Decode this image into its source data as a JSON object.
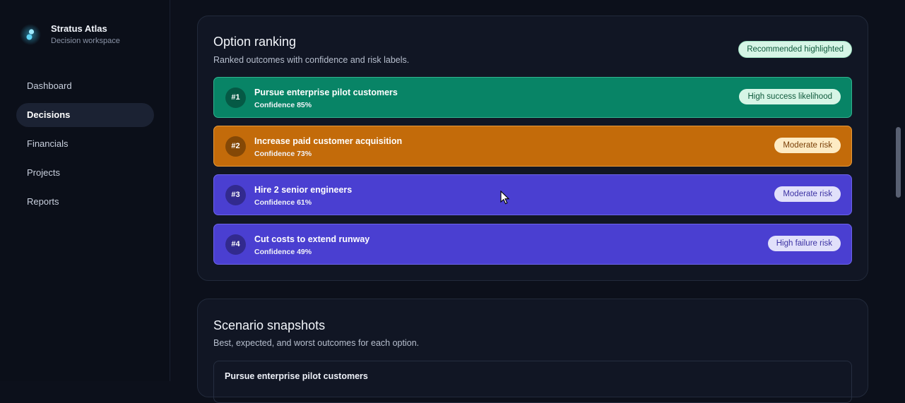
{
  "brand": {
    "name": "Stratus Atlas",
    "subtitle": "Decision workspace",
    "logo_icon": "atlas-logo-icon",
    "accent": "#3ec7f0"
  },
  "nav": [
    {
      "label": "Dashboard",
      "active": false
    },
    {
      "label": "Decisions",
      "active": true
    },
    {
      "label": "Financials",
      "active": false
    },
    {
      "label": "Projects",
      "active": false
    },
    {
      "label": "Reports",
      "active": false
    }
  ],
  "ranking": {
    "title": "Option ranking",
    "subtitle": "Ranked outcomes with confidence and risk labels.",
    "badge": "Recommended highlighted",
    "options": [
      {
        "rank": "#1",
        "title": "Pursue enterprise pilot customers",
        "confidence": "Confidence 85%",
        "tag": "High success likelihood",
        "color": "#088466"
      },
      {
        "rank": "#2",
        "title": "Increase paid customer acquisition",
        "confidence": "Confidence 73%",
        "tag": "Moderate risk",
        "color": "#c36b0a"
      },
      {
        "rank": "#3",
        "title": "Hire 2 senior engineers",
        "confidence": "Confidence 61%",
        "tag": "Moderate risk",
        "color": "#4a3fd1"
      },
      {
        "rank": "#4",
        "title": "Cut costs to extend runway",
        "confidence": "Confidence 49%",
        "tag": "High failure risk",
        "color": "#4a3fd1"
      }
    ]
  },
  "scenarios": {
    "title": "Scenario snapshots",
    "subtitle": "Best, expected, and worst outcomes for each option.",
    "rows": [
      {
        "title": "Pursue enterprise pilot customers"
      }
    ]
  }
}
